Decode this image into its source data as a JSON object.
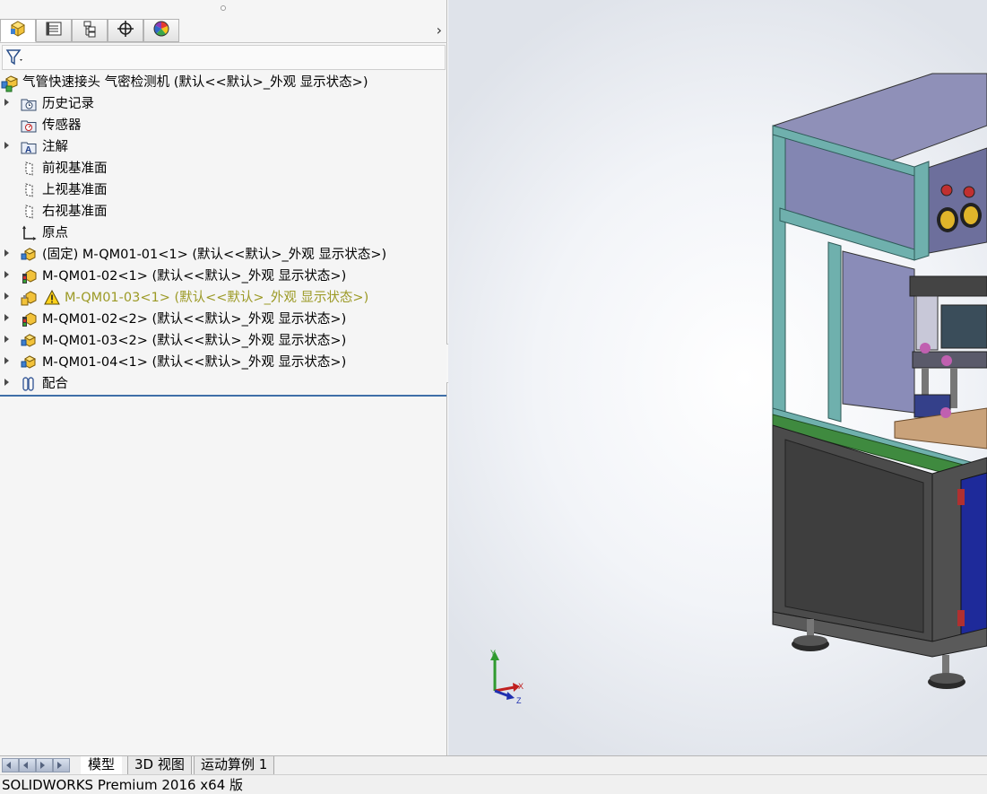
{
  "manager_tabs": [
    {
      "icon": "featuremanager-icon",
      "active": true
    },
    {
      "icon": "propertymanager-icon",
      "active": false
    },
    {
      "icon": "configurationmanager-icon",
      "active": false
    },
    {
      "icon": "dimxpertmanager-icon",
      "active": false
    },
    {
      "icon": "displaymanager-icon",
      "active": false
    }
  ],
  "tree": {
    "root": "气管快速接头 气密检测机  (默认<<默认>_外观 显示状态>)",
    "items": [
      {
        "label": "历史记录",
        "icon": "history-folder-icon"
      },
      {
        "label": "传感器",
        "icon": "sensors-folder-icon"
      },
      {
        "label": "注解",
        "icon": "annotations-folder-icon"
      },
      {
        "label": "前视基准面",
        "icon": "plane-icon"
      },
      {
        "label": "上视基准面",
        "icon": "plane-icon"
      },
      {
        "label": "右视基准面",
        "icon": "plane-icon"
      },
      {
        "label": "原点",
        "icon": "origin-icon"
      },
      {
        "label": "(固定) M-QM01-01<1> (默认<<默认>_外观 显示状态>)",
        "icon": "subassembly-icon"
      },
      {
        "label": "M-QM01-02<1> (默认<<默认>_外观 显示状态>)",
        "icon": "subassembly-icon"
      },
      {
        "label": "M-QM01-03<1> (默认<<默认>_外观 显示状态>)",
        "icon": "subassembly-warning-icon"
      },
      {
        "label": "M-QM01-02<2> (默认<<默认>_外观 显示状态>)",
        "icon": "subassembly-icon"
      },
      {
        "label": "M-QM01-03<2> (默认<<默认>_外观 显示状态>)",
        "icon": "subassembly-icon"
      },
      {
        "label": "M-QM01-04<1> (默认<<默认>_外观 显示状态>)",
        "icon": "subassembly-icon"
      },
      {
        "label": "配合",
        "icon": "mates-icon"
      }
    ]
  },
  "triad": {
    "x": "X",
    "y": "Y",
    "z": "Z"
  },
  "bottom_tabs": [
    "模型",
    "3D 视图",
    "运动算例 1"
  ],
  "status": "SOLIDWORKS Premium 2016 x64 版",
  "colors": {
    "warning_text": "#9c9a26",
    "frame": "#5fa0a0",
    "panel": "#7f80ab",
    "cabinet": "#4b4b4b"
  }
}
